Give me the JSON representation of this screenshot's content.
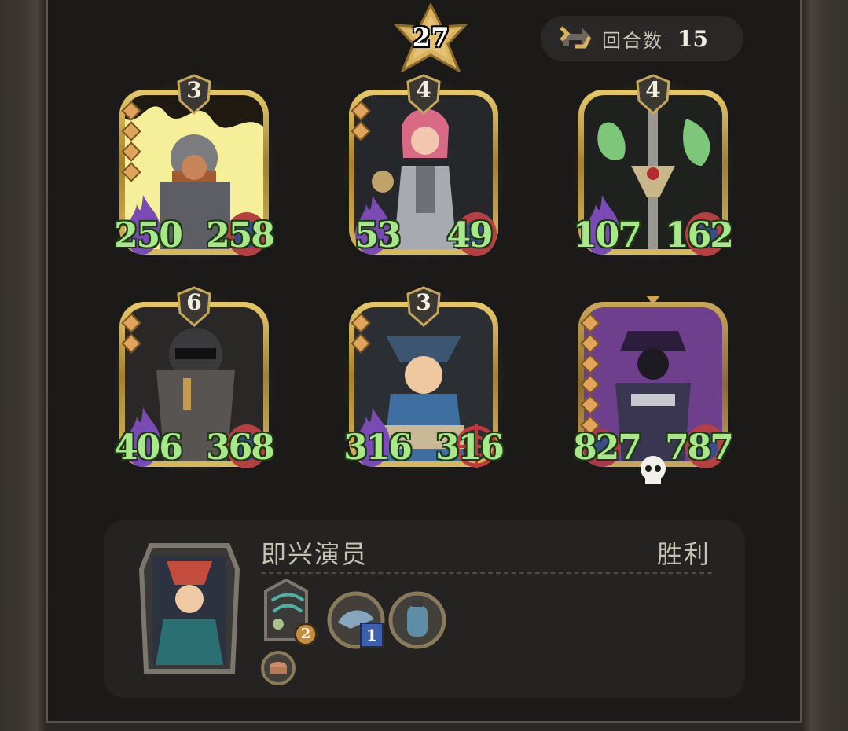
{
  "header": {
    "level": "27",
    "round_label": "回合数",
    "round_value": "15"
  },
  "board": {
    "units": [
      {
        "tier": "3",
        "attack": "250",
        "health": "258",
        "gems": 4
      },
      {
        "tier": "4",
        "attack": "53",
        "health": "49",
        "gems": 2
      },
      {
        "tier": "4",
        "attack": "107",
        "health": "162",
        "gems": 0
      },
      {
        "tier": "6",
        "attack": "406",
        "health": "368",
        "gems": 2
      },
      {
        "tier": "3",
        "attack": "316",
        "health": "316",
        "gems": 2
      },
      {
        "tier": "",
        "attack": "827",
        "health": "787",
        "gems": 7
      }
    ]
  },
  "player": {
    "name": "即兴演员",
    "result": "胜利",
    "items": [
      {
        "icon": "radar-relic-icon",
        "count": "2"
      },
      {
        "icon": "shark-token-icon",
        "count": "1"
      },
      {
        "icon": "bottle-token-icon",
        "count": ""
      },
      {
        "icon": "copper-pot-icon",
        "count": ""
      }
    ]
  },
  "colors": {
    "stat_text": "#a8e88a",
    "gold_frame": "#e7c96a",
    "panel_bg": "#1b1a19"
  }
}
